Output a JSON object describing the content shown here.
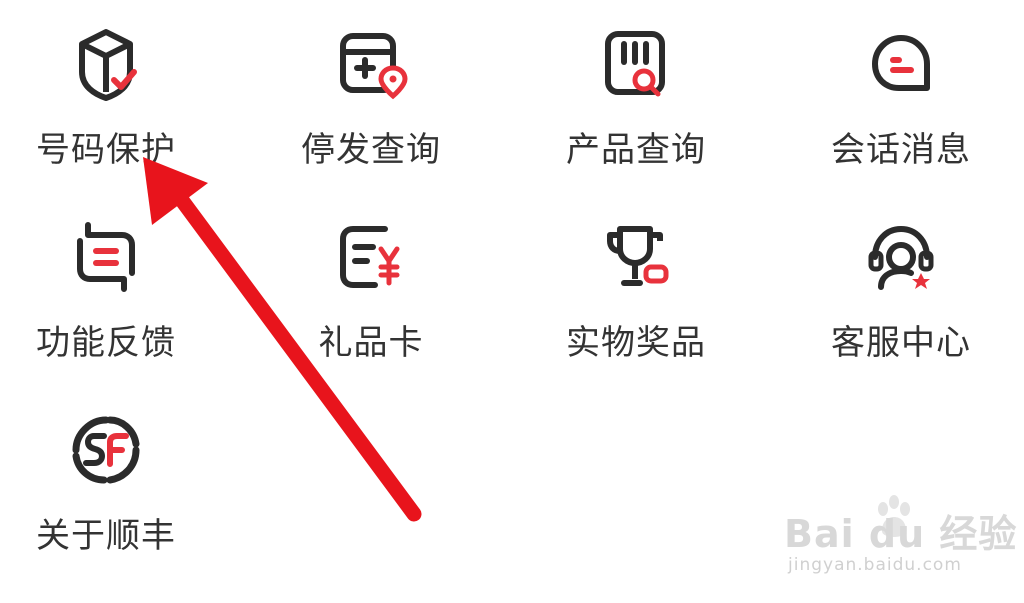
{
  "menu": {
    "items": [
      {
        "label": "号码保护",
        "icon": "box-shield-check-icon"
      },
      {
        "label": "停发查询",
        "icon": "calendar-location-icon"
      },
      {
        "label": "产品查询",
        "icon": "product-search-icon"
      },
      {
        "label": "会话消息",
        "icon": "chat-bubble-icon"
      },
      {
        "label": "功能反馈",
        "icon": "feedback-loop-icon"
      },
      {
        "label": "礼品卡",
        "icon": "gift-card-yuan-icon"
      },
      {
        "label": "实物奖品",
        "icon": "trophy-icon"
      },
      {
        "label": "客服中心",
        "icon": "customer-service-headset-icon"
      },
      {
        "label": "关于顺丰",
        "icon": "sf-logo-icon"
      }
    ]
  },
  "annotation": {
    "type": "red-arrow",
    "points_to": "号码保护",
    "color": "#e8141c"
  },
  "watermark": {
    "brand_text": "Bai du 经验",
    "url_text": "jingyan.baidu.com"
  },
  "colors": {
    "icon_stroke": "#2b2b2b",
    "accent": "#e8323c",
    "label": "#333333"
  }
}
